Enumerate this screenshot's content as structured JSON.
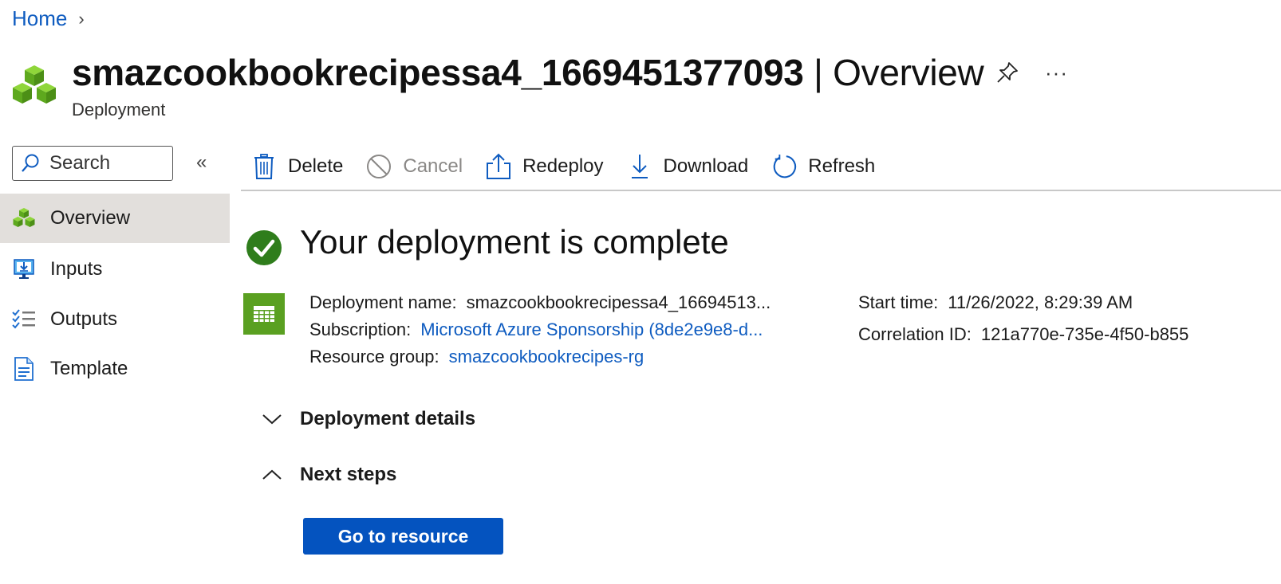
{
  "breadcrumb": {
    "home": "Home",
    "separator": "›"
  },
  "header": {
    "title_name": "smazcookbookrecipessa4_1669451377093",
    "title_separator": "|",
    "title_view": "Overview",
    "subtitle": "Deployment",
    "more_label": "···"
  },
  "search": {
    "placeholder": "Search"
  },
  "sidebar": {
    "collapse_label": "«",
    "items": [
      {
        "label": "Overview",
        "icon": "cubes-icon",
        "active": true
      },
      {
        "label": "Inputs",
        "icon": "monitor-download-icon",
        "active": false
      },
      {
        "label": "Outputs",
        "icon": "checklist-icon",
        "active": false
      },
      {
        "label": "Template",
        "icon": "document-icon",
        "active": false
      }
    ]
  },
  "toolbar": {
    "delete": "Delete",
    "cancel": "Cancel",
    "redeploy": "Redeploy",
    "download": "Download",
    "refresh": "Refresh"
  },
  "status": {
    "heading": "Your deployment is complete",
    "deployment_name_label": "Deployment name:",
    "deployment_name_value": "smazcookbookrecipessa4_16694513...",
    "subscription_label": "Subscription:",
    "subscription_value": "Microsoft Azure Sponsorship (8de2e9e8-d...",
    "resource_group_label": "Resource group:",
    "resource_group_value": "smazcookbookrecipes-rg",
    "start_time_label": "Start time:",
    "start_time_value": "11/26/2022, 8:29:39 AM",
    "correlation_label": "Correlation ID:",
    "correlation_value": "121a770e-735e-4f50-b855"
  },
  "sections": {
    "details": "Deployment details",
    "next_steps": "Next steps"
  },
  "actions": {
    "go_to_resource": "Go to resource"
  },
  "colors": {
    "accent": "#0f5cc0",
    "primary_button": "#0453bf",
    "success": "#2f7d1c",
    "active_nav": "#e2dfdc"
  }
}
